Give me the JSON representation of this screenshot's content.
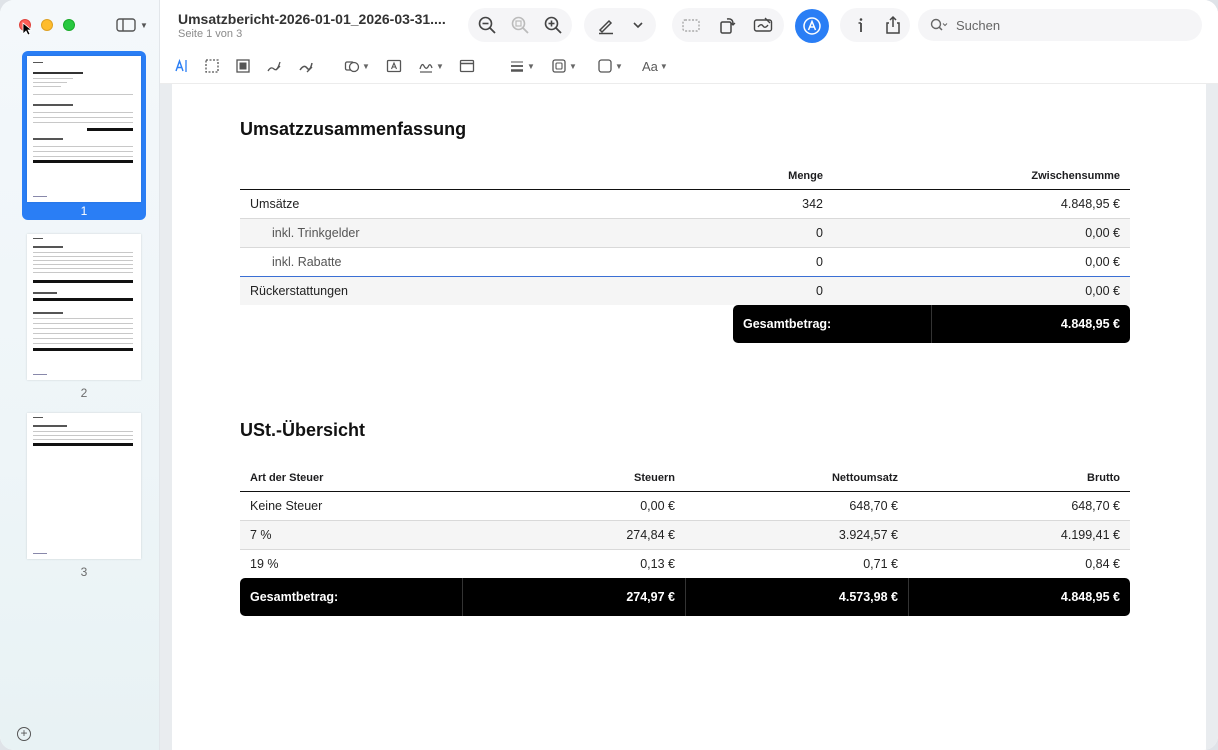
{
  "window": {
    "title": "Umsatzbericht-2026-01-01_2026-03-31....",
    "subtitle": "Seite 1 von 3"
  },
  "search": {
    "placeholder": "Suchen"
  },
  "sidebar": {
    "thumbnails": [
      {
        "number": "1",
        "selected": true
      },
      {
        "number": "2",
        "selected": false
      },
      {
        "number": "3",
        "selected": false
      }
    ]
  },
  "toolbar": {
    "icons": [
      "zoom-out-icon",
      "zoom-fit-icon",
      "zoom-in-icon",
      "highlight-pen-icon",
      "chevron-down-icon",
      "redact-icon",
      "rotate-icon",
      "signature-icon",
      "markup-icon",
      "info-icon",
      "share-icon",
      "search-icon"
    ],
    "markup_tools": [
      "text-selection-icon",
      "rect-select-icon",
      "redact-box-icon",
      "sketch-icon",
      "draw-icon",
      "shapes-icon",
      "textbox-icon",
      "sign-icon",
      "note-icon",
      "line-style-icon",
      "border-color-icon",
      "fill-color-icon",
      "font-icon"
    ],
    "font_label": "Aa"
  },
  "colors": {
    "accent": "#2a7ef5",
    "total_bg": "#000000"
  },
  "summary": {
    "title": "Umsatzzusammenfassung",
    "headers": {
      "name": "",
      "qty": "Menge",
      "subtotal": "Zwischensumme"
    },
    "rows": [
      {
        "name": "Umsätze",
        "qty": "342",
        "subtotal": "4.848,95 €"
      },
      {
        "name": "inkl. Trinkgelder",
        "qty": "0",
        "subtotal": "0,00 €"
      },
      {
        "name": "inkl. Rabatte",
        "qty": "0",
        "subtotal": "0,00 €"
      },
      {
        "name": "Rückerstattungen",
        "qty": "0",
        "subtotal": "0,00 €"
      }
    ],
    "total_label": "Gesamtbetrag:",
    "total_value": "4.848,95 €"
  },
  "vat": {
    "title": "USt.-Übersicht",
    "headers": {
      "type": "Art der Steuer",
      "tax": "Steuern",
      "net": "Nettoumsatz",
      "gross": "Brutto"
    },
    "rows": [
      {
        "type": "Keine Steuer",
        "tax": "0,00 €",
        "net": "648,70 €",
        "gross": "648,70 €"
      },
      {
        "type": "7 %",
        "tax": "274,84 €",
        "net": "3.924,57 €",
        "gross": "4.199,41 €"
      },
      {
        "type": "19 %",
        "tax": "0,13 €",
        "net": "0,71 €",
        "gross": "0,84 €"
      }
    ],
    "total": {
      "label": "Gesamtbetrag:",
      "tax": "274,97 €",
      "net": "4.573,98 €",
      "gross": "4.848,95 €"
    }
  }
}
